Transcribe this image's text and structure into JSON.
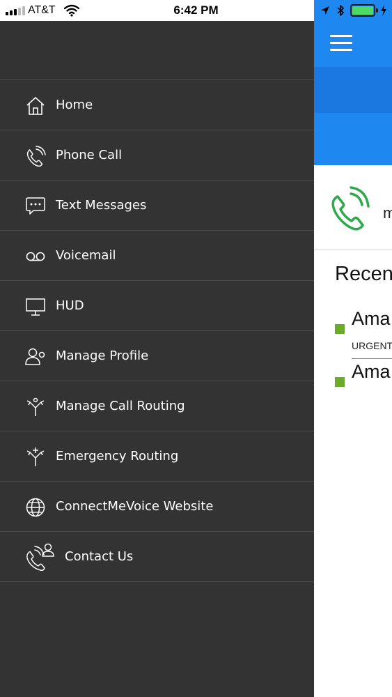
{
  "status_bar": {
    "carrier": "AT&T",
    "time": "6:42 PM",
    "battery_level": 1.0
  },
  "drawer": {
    "menu": [
      {
        "label": "Home",
        "icon": "home-icon"
      },
      {
        "label": "Phone Call",
        "icon": "phone-call-icon"
      },
      {
        "label": "Text Messages",
        "icon": "chat-bubble-icon"
      },
      {
        "label": "Voicemail",
        "icon": "voicemail-icon"
      },
      {
        "label": "HUD",
        "icon": "monitor-icon"
      },
      {
        "label": "Manage Profile",
        "icon": "profile-icon"
      },
      {
        "label": "Manage Call Routing",
        "icon": "call-routing-icon"
      },
      {
        "label": "Emergency Routing",
        "icon": "emergency-routing-icon"
      },
      {
        "label": "ConnectMeVoice Website",
        "icon": "globe-icon"
      },
      {
        "label": "Contact Us",
        "icon": "contact-phone-icon"
      }
    ]
  },
  "app": {
    "call_row_text": "m",
    "recent_title": "Recen",
    "recent_items": [
      {
        "name": "Ama",
        "sub": "URGENT"
      },
      {
        "name": "Ama",
        "sub": ""
      }
    ],
    "colors": {
      "header_blue": "#1e88f0",
      "drawer_bg": "#333333",
      "call_icon_green": "#2eaa4a",
      "status_dot_green": "#6aac2a"
    }
  }
}
